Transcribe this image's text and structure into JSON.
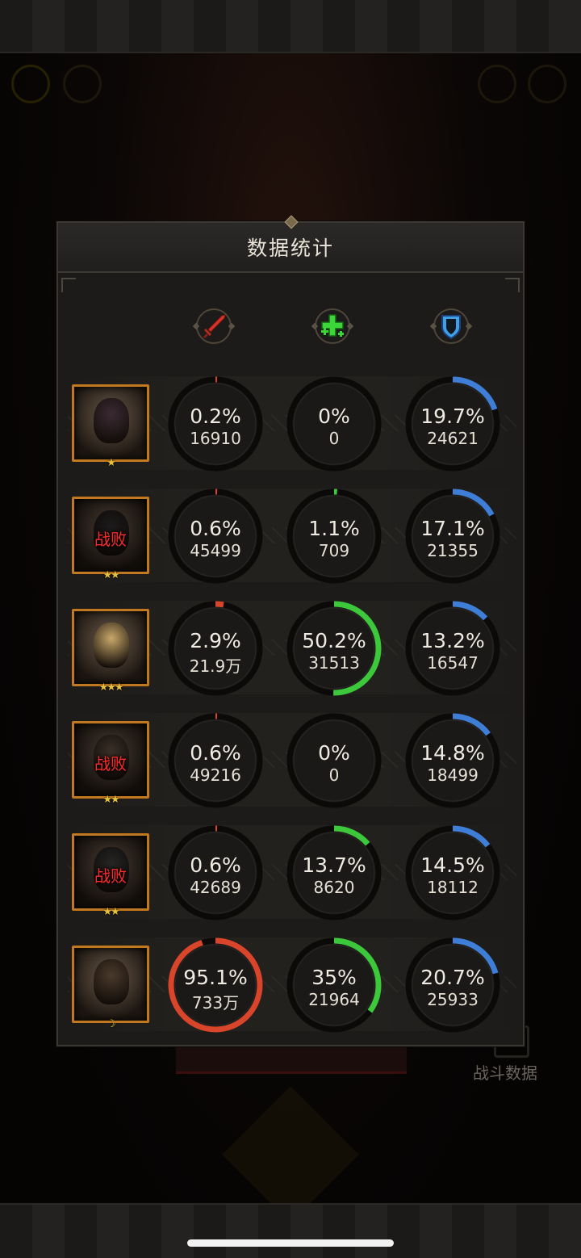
{
  "panel": {
    "title": "数据统计"
  },
  "background": {
    "battle_data_label": "战斗数据"
  },
  "columns": [
    {
      "name": "damage",
      "icon": "sword-icon",
      "color": "#d8452a"
    },
    {
      "name": "healing",
      "icon": "heal-cross-icon",
      "color": "#3cc83a"
    },
    {
      "name": "defense",
      "icon": "shield-icon",
      "color": "#3f7ed6"
    }
  ],
  "rows": [
    {
      "defeated": false,
      "defeat_label": "",
      "stars": "★",
      "portrait": "dark-warrior",
      "damage": {
        "pct": "0.2%",
        "value": "16910",
        "fraction": 0.002
      },
      "heal": {
        "pct": "0%",
        "value": "0",
        "fraction": 0.0
      },
      "defense": {
        "pct": "19.7%",
        "value": "24621",
        "fraction": 0.197
      }
    },
    {
      "defeated": true,
      "defeat_label": "战败",
      "stars": "★★",
      "portrait": "beast",
      "damage": {
        "pct": "0.6%",
        "value": "45499",
        "fraction": 0.006
      },
      "heal": {
        "pct": "1.1%",
        "value": "709",
        "fraction": 0.011
      },
      "defense": {
        "pct": "17.1%",
        "value": "21355",
        "fraction": 0.171
      }
    },
    {
      "defeated": false,
      "defeat_label": "",
      "stars": "★★★",
      "portrait": "blonde-knight",
      "damage": {
        "pct": "2.9%",
        "value": "21.9万",
        "fraction": 0.029
      },
      "heal": {
        "pct": "50.2%",
        "value": "31513",
        "fraction": 0.502
      },
      "defense": {
        "pct": "13.2%",
        "value": "16547",
        "fraction": 0.132
      }
    },
    {
      "defeated": true,
      "defeat_label": "战败",
      "stars": "★★",
      "portrait": "masked-rogue",
      "damage": {
        "pct": "0.6%",
        "value": "49216",
        "fraction": 0.006
      },
      "heal": {
        "pct": "0%",
        "value": "0",
        "fraction": 0.0
      },
      "defense": {
        "pct": "14.8%",
        "value": "18499",
        "fraction": 0.148
      }
    },
    {
      "defeated": true,
      "defeat_label": "战败",
      "stars": "★★",
      "portrait": "horned-mage",
      "damage": {
        "pct": "0.6%",
        "value": "42689",
        "fraction": 0.006
      },
      "heal": {
        "pct": "13.7%",
        "value": "8620",
        "fraction": 0.137
      },
      "defense": {
        "pct": "14.5%",
        "value": "18112",
        "fraction": 0.145
      }
    },
    {
      "defeated": false,
      "defeat_label": "",
      "stars": "☽",
      "portrait": "dark-haired-heroine",
      "damage": {
        "pct": "95.1%",
        "value": "733万",
        "fraction": 0.951
      },
      "heal": {
        "pct": "35%",
        "value": "21964",
        "fraction": 0.35
      },
      "defense": {
        "pct": "20.7%",
        "value": "25933",
        "fraction": 0.207
      }
    }
  ]
}
